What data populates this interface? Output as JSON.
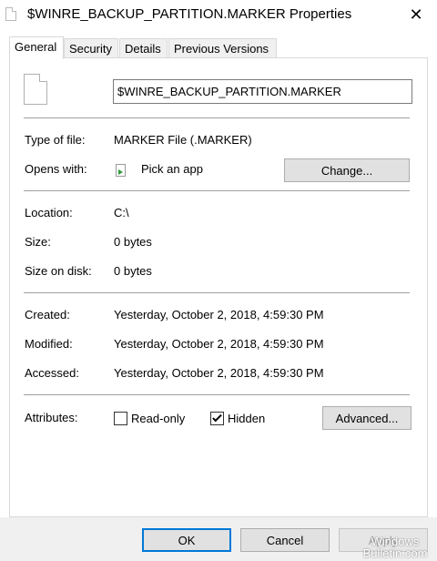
{
  "window": {
    "title": "$WINRE_BACKUP_PARTITION.MARKER Properties",
    "close_glyph": "✕"
  },
  "tabs": [
    {
      "label": "General",
      "active": true
    },
    {
      "label": "Security",
      "active": false
    },
    {
      "label": "Details",
      "active": false
    },
    {
      "label": "Previous Versions",
      "active": false
    }
  ],
  "general": {
    "file_name": "$WINRE_BACKUP_PARTITION.MARKER",
    "type_label": "Type of file:",
    "type_value": "MARKER File (.MARKER)",
    "opens_label": "Opens with:",
    "opens_value": "Pick an app",
    "change_button": "Change...",
    "location_label": "Location:",
    "location_value": "C:\\",
    "size_label": "Size:",
    "size_value": "0 bytes",
    "size_on_disk_label": "Size on disk:",
    "size_on_disk_value": "0 bytes",
    "created_label": "Created:",
    "created_value": "Yesterday, October 2, 2018, 4:59:30 PM",
    "modified_label": "Modified:",
    "modified_value": "Yesterday, October 2, 2018, 4:59:30 PM",
    "accessed_label": "Accessed:",
    "accessed_value": "Yesterday, October 2, 2018, 4:59:30 PM",
    "attributes_label": "Attributes:",
    "readonly_label": "Read-only",
    "readonly_checked": false,
    "hidden_label": "Hidden",
    "hidden_checked": true,
    "advanced_button": "Advanced..."
  },
  "footer": {
    "ok_button": "OK",
    "cancel_button": "Cancel",
    "apply_button": "Apply",
    "watermark_line1": "Windows",
    "watermark_line2": "Bulletin.com"
  },
  "colors": {
    "accent": "#0078d7",
    "footer_bg": "#f0f0f0",
    "separator": "#a0a0a0"
  }
}
